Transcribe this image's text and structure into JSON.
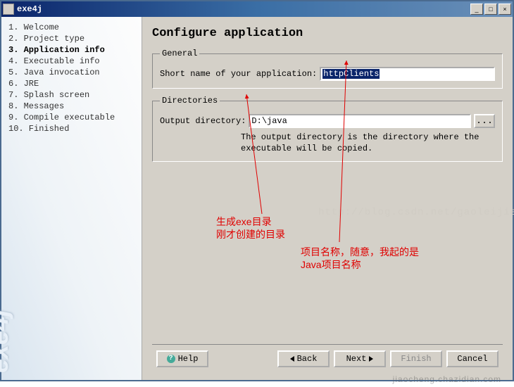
{
  "window": {
    "title": "exe4j"
  },
  "sidebar": {
    "steps": [
      "Welcome",
      "Project type",
      "Application info",
      "Executable info",
      "Java invocation",
      "JRE",
      "Splash screen",
      "Messages",
      "Compile executable",
      "Finished"
    ],
    "activeIndex": 2,
    "brand": "exe4j"
  },
  "content": {
    "title": "Configure application",
    "general": {
      "legend": "General",
      "shortNameLabel": "Short name of your application:",
      "shortNameValue": "httpClients"
    },
    "directories": {
      "legend": "Directories",
      "outputLabel": "Output directory:",
      "outputValue": "D:\\java",
      "browseLabel": "...",
      "hint": "The output directory is the directory where the executable will be copied."
    },
    "watermark": "http://blog.csdn.net/gaoleijie",
    "bottomWatermark": "jiaocheng.chazidian.com"
  },
  "annotations": {
    "a1_line1": "生成exe目录",
    "a1_line2": "刚才创建的目录",
    "a2_line1": "项目名称，随意，我起的是",
    "a2_line2": "Java项目名称"
  },
  "buttons": {
    "help": "Help",
    "back": "Back",
    "next": "Next",
    "finish": "Finish",
    "cancel": "Cancel"
  }
}
